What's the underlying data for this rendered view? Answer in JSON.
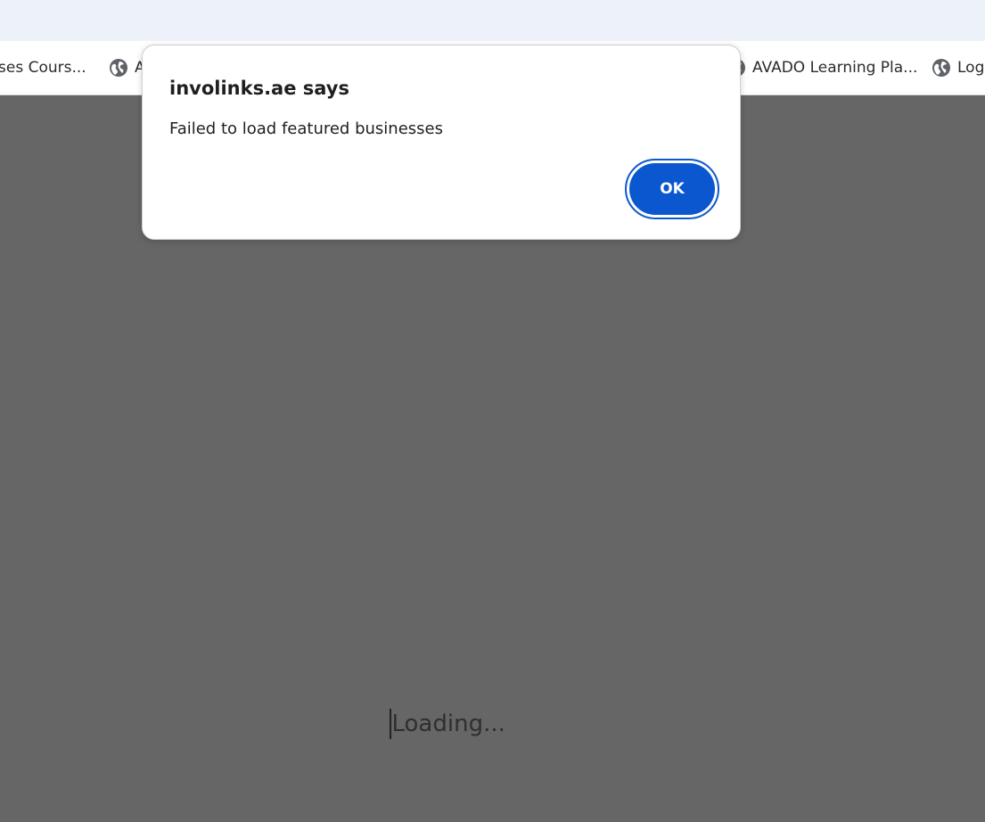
{
  "bookmarks": [
    {
      "label": "ses Cours...",
      "icon": "none"
    },
    {
      "label": "A",
      "icon": "globe-icon"
    },
    {
      "label": "AVADO Learning Pla...",
      "icon": "globe-icon"
    },
    {
      "label": "Log",
      "icon": "globe-icon"
    }
  ],
  "dialog": {
    "title": "involinks.ae says",
    "message": "Failed to load featured businesses",
    "ok_label": "OK"
  },
  "page": {
    "loading_text": "Loading..."
  },
  "colors": {
    "topbar": "#edf1f9",
    "overlay": "#666666",
    "accent": "#0b57d0"
  }
}
